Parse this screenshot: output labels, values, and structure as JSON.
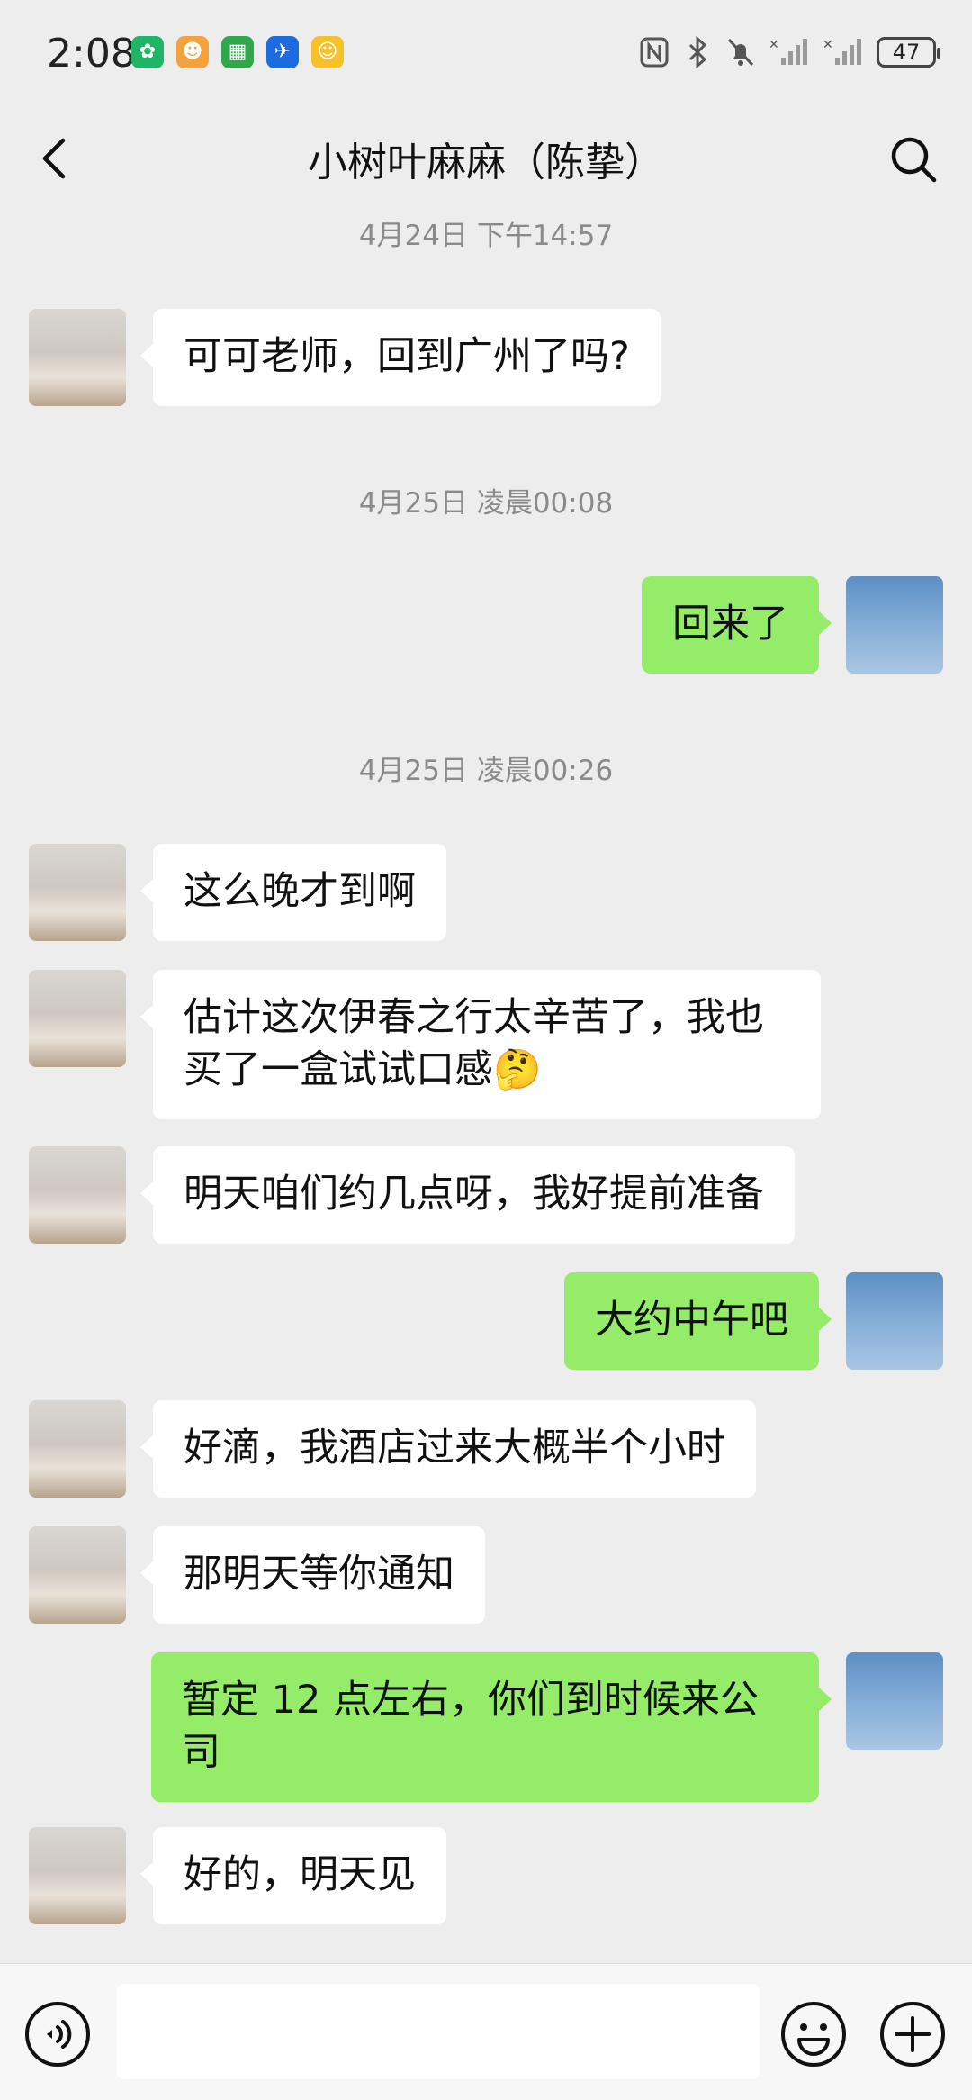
{
  "status_bar": {
    "time": "2:08",
    "battery": "47",
    "app_icons": [
      "leaf-app-icon",
      "character-app-icon",
      "grid-app-icon",
      "plane-app-icon",
      "cartoon-app-icon"
    ]
  },
  "header": {
    "title": "小树叶麻麻（陈挚）",
    "back_icon": "chevron-left-icon",
    "search_icon": "search-icon"
  },
  "messages": [
    {
      "type": "time",
      "text": "4月24日 下午14:57"
    },
    {
      "type": "in",
      "text": "可可老师，回到广州了吗?"
    },
    {
      "type": "time",
      "text": "4月25日 凌晨00:08"
    },
    {
      "type": "out",
      "text": "回来了"
    },
    {
      "type": "time",
      "text": "4月25日 凌晨00:26"
    },
    {
      "type": "in",
      "text": "这么晚才到啊"
    },
    {
      "type": "in",
      "text": "估计这次伊春之行太辛苦了，我也买了一盒试试口感🤔"
    },
    {
      "type": "in",
      "text": "明天咱们约几点呀，我好提前准备"
    },
    {
      "type": "out",
      "text": "大约中午吧"
    },
    {
      "type": "in",
      "text": "好滴，我酒店过来大概半个小时"
    },
    {
      "type": "in",
      "text": "那明天等你通知"
    },
    {
      "type": "out",
      "text": "暂定 12 点左右，你们到时候来公司"
    },
    {
      "type": "in",
      "text": "好的，明天见"
    }
  ],
  "input_bar": {
    "voice_icon": "voice-icon",
    "text_value": "",
    "emoji_icon": "emoji-icon",
    "plus_icon": "plus-icon"
  },
  "colors": {
    "background": "#ededed",
    "outgoing_bubble": "#95ec69",
    "incoming_bubble": "#ffffff"
  }
}
